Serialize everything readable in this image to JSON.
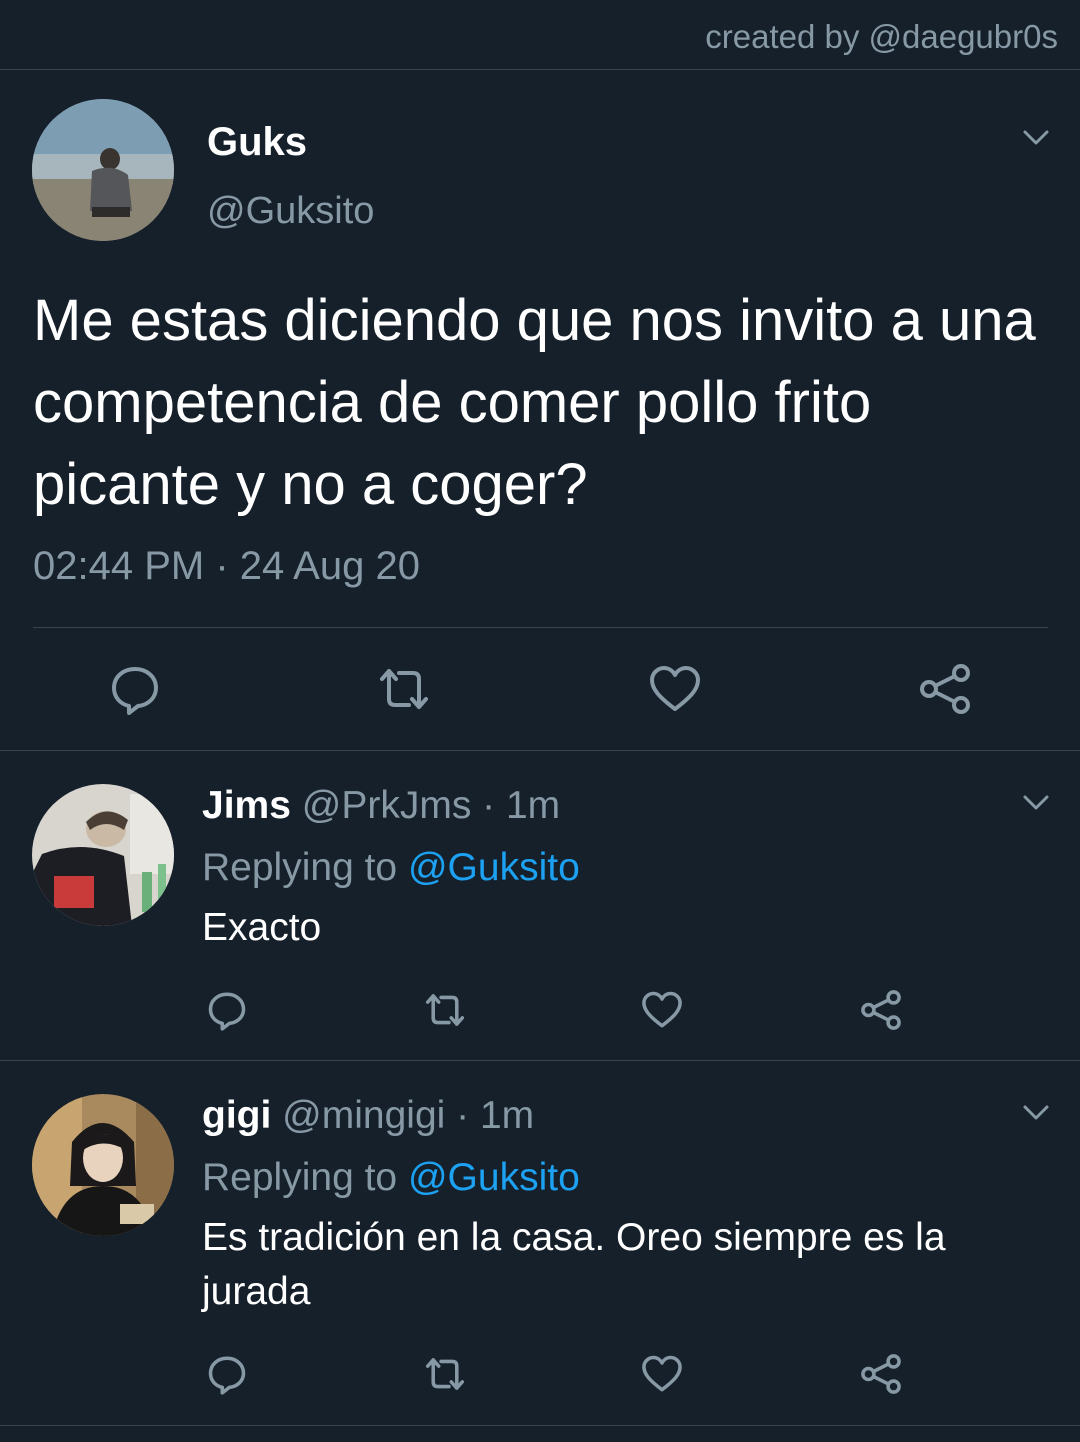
{
  "credit": "created by @daegubr0s",
  "main_tweet": {
    "name": "Guks",
    "handle": "@Guksito",
    "text": "Me estas diciendo que nos invito a una competencia de comer pollo frito picante y no a coger?",
    "timestamp": "02:44 PM · 24 Aug 20",
    "actions": [
      "reply-icon",
      "retweet-icon",
      "like-icon",
      "share-icon"
    ]
  },
  "replies": [
    {
      "name": "Jims",
      "handle_time": " @PrkJms · 1m",
      "replying_prefix": "Replying to ",
      "replying_mention": "@Guksito",
      "text": "Exacto"
    },
    {
      "name": "gigi",
      "handle_time": " @mingigi · 1m",
      "replying_prefix": "Replying to ",
      "replying_mention": "@Guksito",
      "text": "Es tradición en la casa. Oreo siempre es la jurada"
    }
  ],
  "colors": {
    "background": "#15202b",
    "secondary_text": "#8899a6",
    "accent": "#1da1f2",
    "divider": "#38444d"
  }
}
